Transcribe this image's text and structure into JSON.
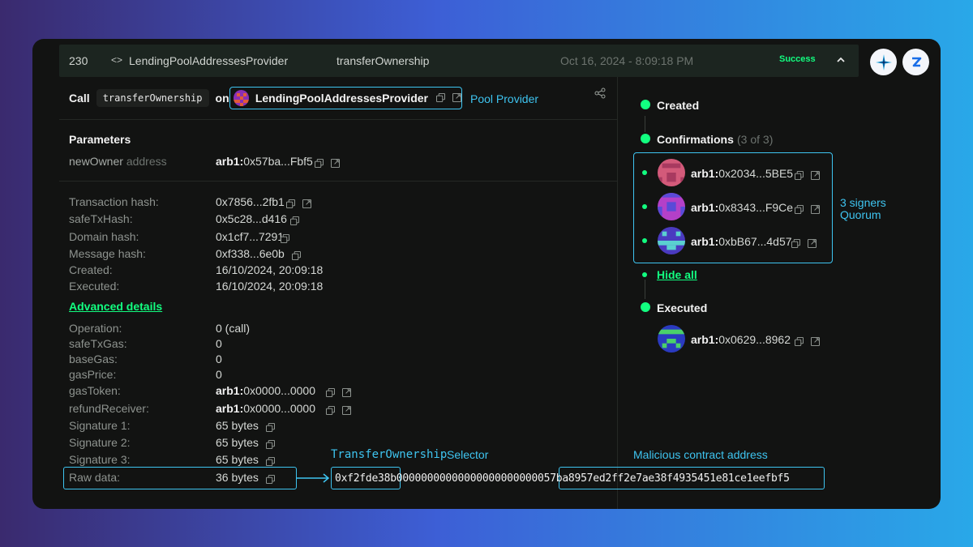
{
  "header": {
    "nonce": "230",
    "code_icon": "<>",
    "contract": "LendingPoolAddressesProvider",
    "method": "transferOwnership",
    "date": "Oct 16, 2024 - 8:09:18 PM",
    "status": "Success",
    "status_color": "#12ff80"
  },
  "call": {
    "call_label": "Call",
    "method": "transferOwnership",
    "on_label": "on",
    "contract": "LendingPoolAddressesProvider",
    "annotation": "Pool  Provider"
  },
  "parameters": {
    "title": "Parameters",
    "name": "newOwner",
    "type": "address",
    "prefix": "arb1:",
    "value": "0x57ba...Fbf5"
  },
  "tx_details": [
    {
      "label": "Transaction hash:",
      "value": "0x7856...2fb1"
    },
    {
      "label": "safeTxHash:",
      "value": "0x5c28...d416"
    },
    {
      "label": "Domain hash:",
      "value": "0x1cf7...7291"
    },
    {
      "label": "Message hash:",
      "value": "0xf338...6e0b"
    },
    {
      "label": "Created:",
      "value": "16/10/2024, 20:09:18"
    },
    {
      "label": "Executed:",
      "value": "16/10/2024, 20:09:18"
    }
  ],
  "advanced_link": "Advanced details",
  "advanced": [
    {
      "label": "Operation:",
      "value": "0 (call)"
    },
    {
      "label": "safeTxGas:",
      "value": "0"
    },
    {
      "label": "baseGas:",
      "value": "0"
    },
    {
      "label": "gasPrice:",
      "value": "0"
    },
    {
      "label": "gasToken:",
      "prefix": "arb1:",
      "value": "0x0000...0000"
    },
    {
      "label": "refundReceiver:",
      "prefix": "arb1:",
      "value": "0x0000...0000"
    },
    {
      "label": "Signature 1:",
      "value": "65 bytes"
    },
    {
      "label": "Signature 2:",
      "value": "65 bytes"
    },
    {
      "label": "Signature 3:",
      "value": "65 bytes"
    },
    {
      "label": "Raw data:",
      "value": "36 bytes"
    }
  ],
  "raw_data": {
    "selector": "0xf2fde38b",
    "padding": "000000000000000000000000",
    "address": "57ba8957ed2ff2e7ae38f4935451e81ce1eefbf5",
    "selector_annotation_mono": "TransferOwnership",
    "selector_annotation": "Selector",
    "address_annotation": "Malicious contract address"
  },
  "timeline": {
    "created": "Created",
    "confirmations": "Confirmations",
    "confirmations_count": "(3 of 3)",
    "signers": [
      {
        "prefix": "arb1:",
        "address": "0x2034...5BE5"
      },
      {
        "prefix": "arb1:",
        "address": "0x8343...F9Ce"
      },
      {
        "prefix": "arb1:",
        "address": "0xbB67...4d57"
      }
    ],
    "signers_annotation_1": "3 signers",
    "signers_annotation_2": "Quorum",
    "hide_all": "Hide all",
    "executed": "Executed",
    "executor": {
      "prefix": "arb1:",
      "address": "0x0629...8962"
    }
  },
  "colors": {
    "accent_green": "#12ff80",
    "annotation_cyan": "#3ec4f0"
  }
}
